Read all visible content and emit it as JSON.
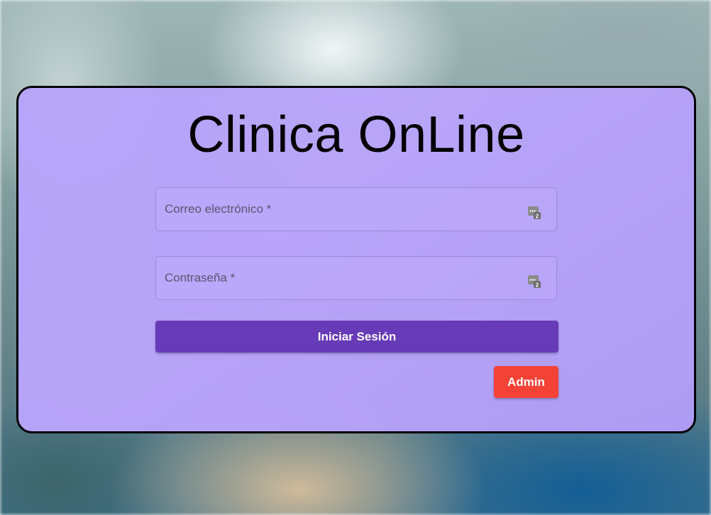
{
  "app": {
    "title": "Clinica OnLine"
  },
  "form": {
    "email": {
      "placeholder": "Correo electrónico *",
      "value": "",
      "icon": "password-manager-icon"
    },
    "password": {
      "placeholder": "Contraseña *",
      "value": "",
      "icon": "password-manager-icon"
    },
    "login_label": "Iniciar Sesión",
    "admin_label": "Admin"
  },
  "colors": {
    "card_background": "#b9a5fb",
    "primary_button": "#673ab7",
    "admin_button": "#f44336",
    "card_border": "#000000"
  }
}
